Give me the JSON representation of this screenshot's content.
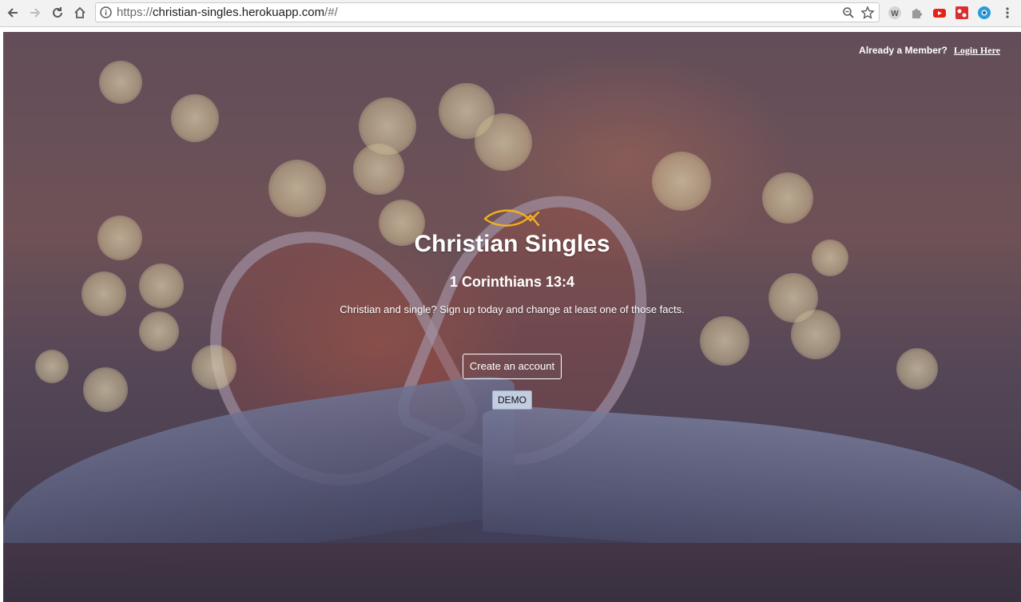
{
  "browser": {
    "url_scheme": "https://",
    "url_host": "christian-singles.herokuapp.com",
    "url_path": "/#/",
    "icons": [
      "back-icon",
      "forward-icon",
      "reload-icon",
      "home-icon",
      "info-icon",
      "zoom-icon",
      "star-icon",
      "extension-w-icon",
      "puzzle-icon",
      "youtube-icon",
      "game-icon",
      "chrome-icon",
      "menu-dots-icon"
    ]
  },
  "header": {
    "member_prompt": "Already a Member?",
    "login_label": "Login Here"
  },
  "hero": {
    "icon": "ichthys-fish-icon",
    "title": "Christian Singles",
    "verse": "1 Corinthians 13:4",
    "tagline": "Christian and single? Sign up today and change at least one of those facts.",
    "create_account_label": "Create an account",
    "demo_label": "DEMO"
  },
  "colors": {
    "fish": "#f0b020",
    "demo_button_bg": "#c2cde2",
    "text": "#ffffff"
  }
}
